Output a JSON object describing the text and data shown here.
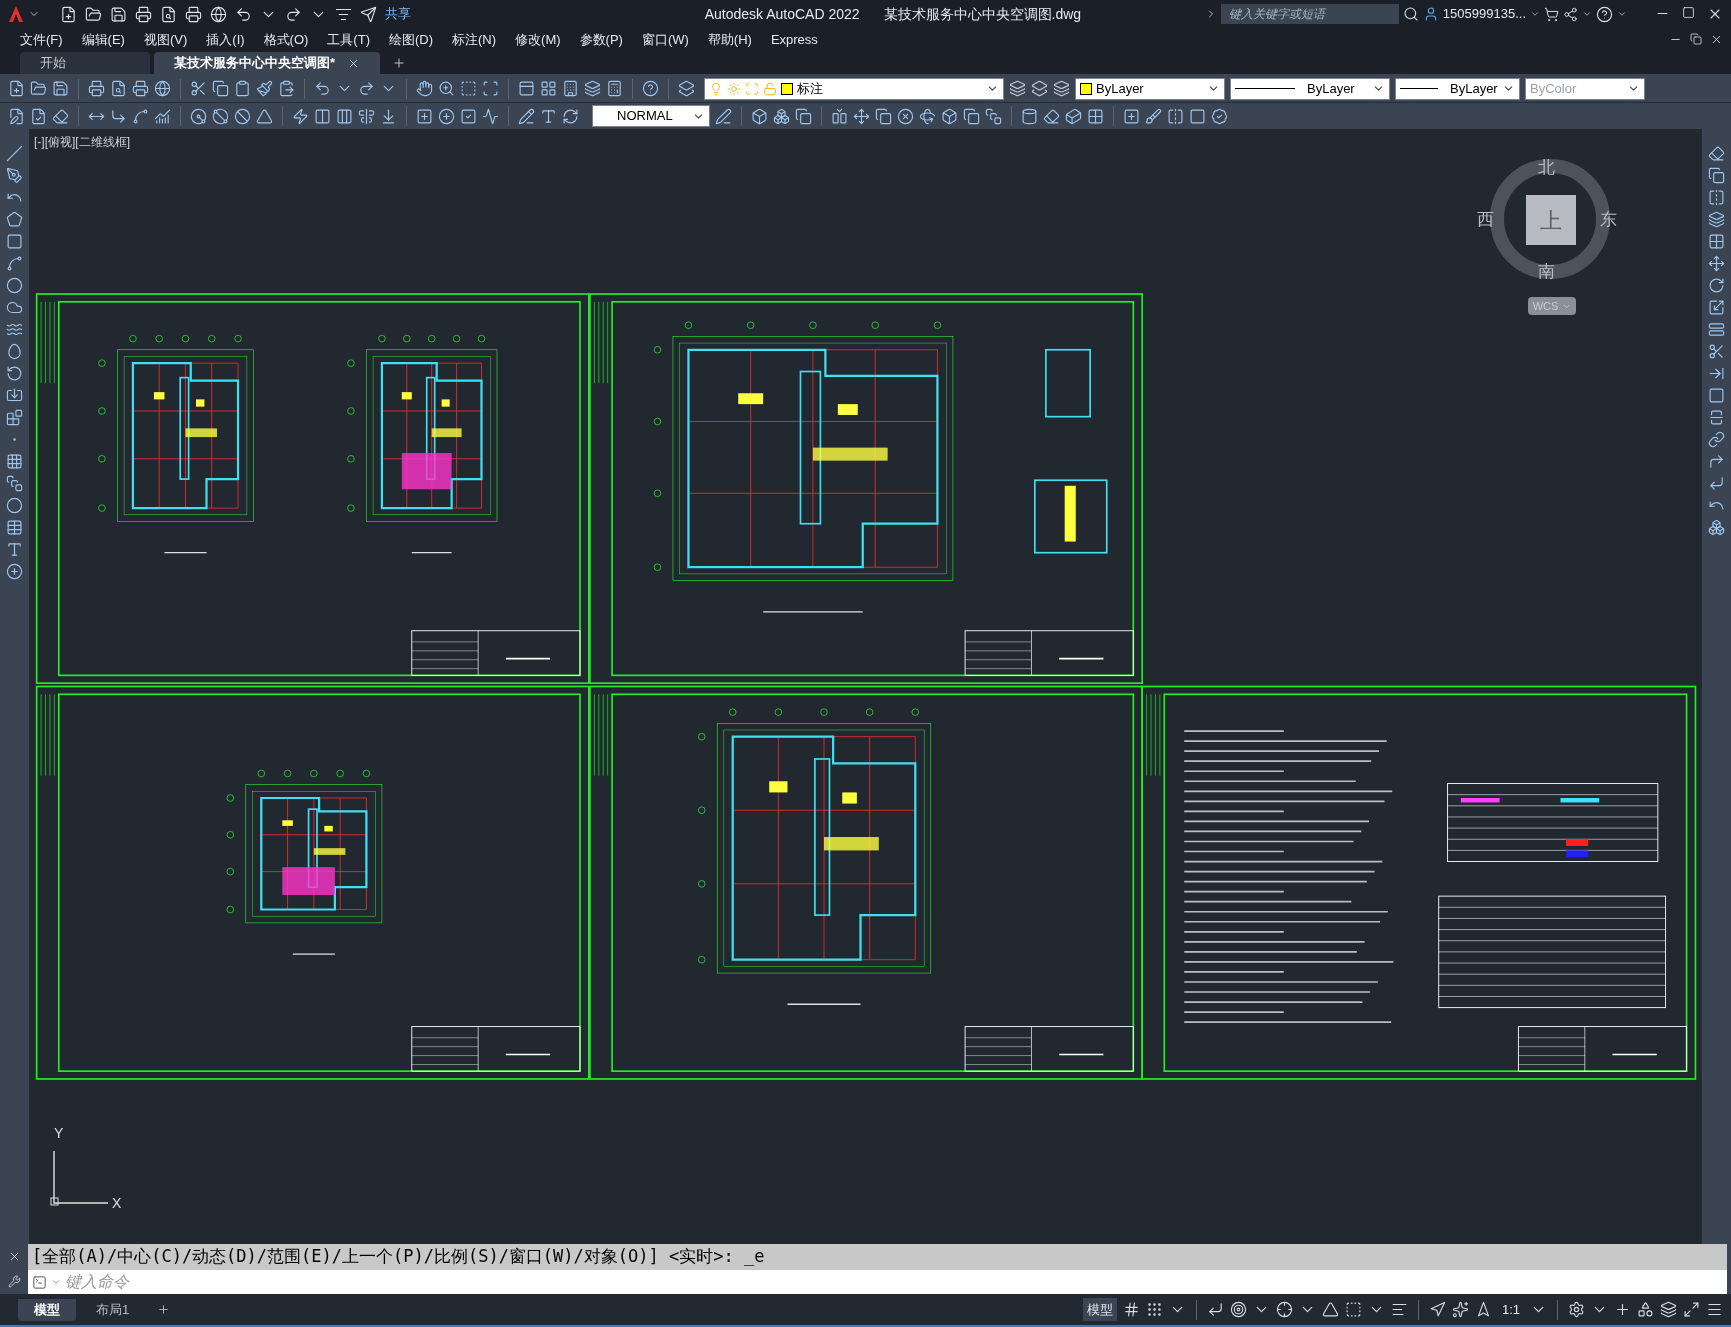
{
  "title_bar": {
    "share": "共享",
    "app_title": "Autodesk AutoCAD 2022",
    "file_name": "某技术服务中心中央空调图.dwg",
    "search": {
      "placeholder": "键入关键字或短语"
    },
    "user": "1505999135..."
  },
  "menu_bar": [
    "文件(F)",
    "编辑(E)",
    "视图(V)",
    "插入(I)",
    "格式(O)",
    "工具(T)",
    "绘图(D)",
    "标注(N)",
    "修改(M)",
    "参数(P)",
    "窗口(W)",
    "帮助(H)",
    "Express"
  ],
  "document_tabs": [
    {
      "label": "开始",
      "selected": false
    },
    {
      "label": "某技术服务中心中央空调图*",
      "selected": true
    }
  ],
  "properties_toolbar": {
    "layer": "标注",
    "color_setting": "ByLayer",
    "linetype": "ByLayer",
    "lineweight": "ByLayer",
    "plot_style": "ByColor"
  },
  "style_toolbar": {
    "dim_style": "NORMAL"
  },
  "viewport_label": "[-][俯视][二维线框]",
  "viewcube": {
    "north": "北",
    "west": "西",
    "east": "东",
    "south": "南",
    "face": "上",
    "ucs": "WCS"
  },
  "ucs_icon": {
    "y": "Y",
    "x": "X"
  },
  "command_line": {
    "history": "[全部(A)/中心(C)/动态(D)/范围(E)/上一个(P)/比例(S)/窗口(W)/对象(O)] <实时>: _e",
    "placeholder": "键入命令"
  },
  "layout_tabs": [
    {
      "label": "模型",
      "selected": true
    },
    {
      "label": "布局1",
      "selected": false
    }
  ],
  "status_bar": {
    "model": "模型",
    "scale": "1:1"
  }
}
